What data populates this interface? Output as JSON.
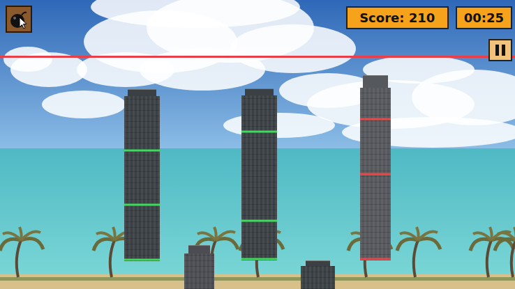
{
  "score": "Score: 210",
  "timer": "00:25",
  "towers": [
    {
      "kind": "tall",
      "color": "#3ddc5a"
    },
    {
      "kind": "tall",
      "color": "#3ddc5a"
    },
    {
      "kind": "tall",
      "color": "#e8484a"
    },
    {
      "kind": "stub"
    },
    {
      "kind": "stub"
    }
  ]
}
